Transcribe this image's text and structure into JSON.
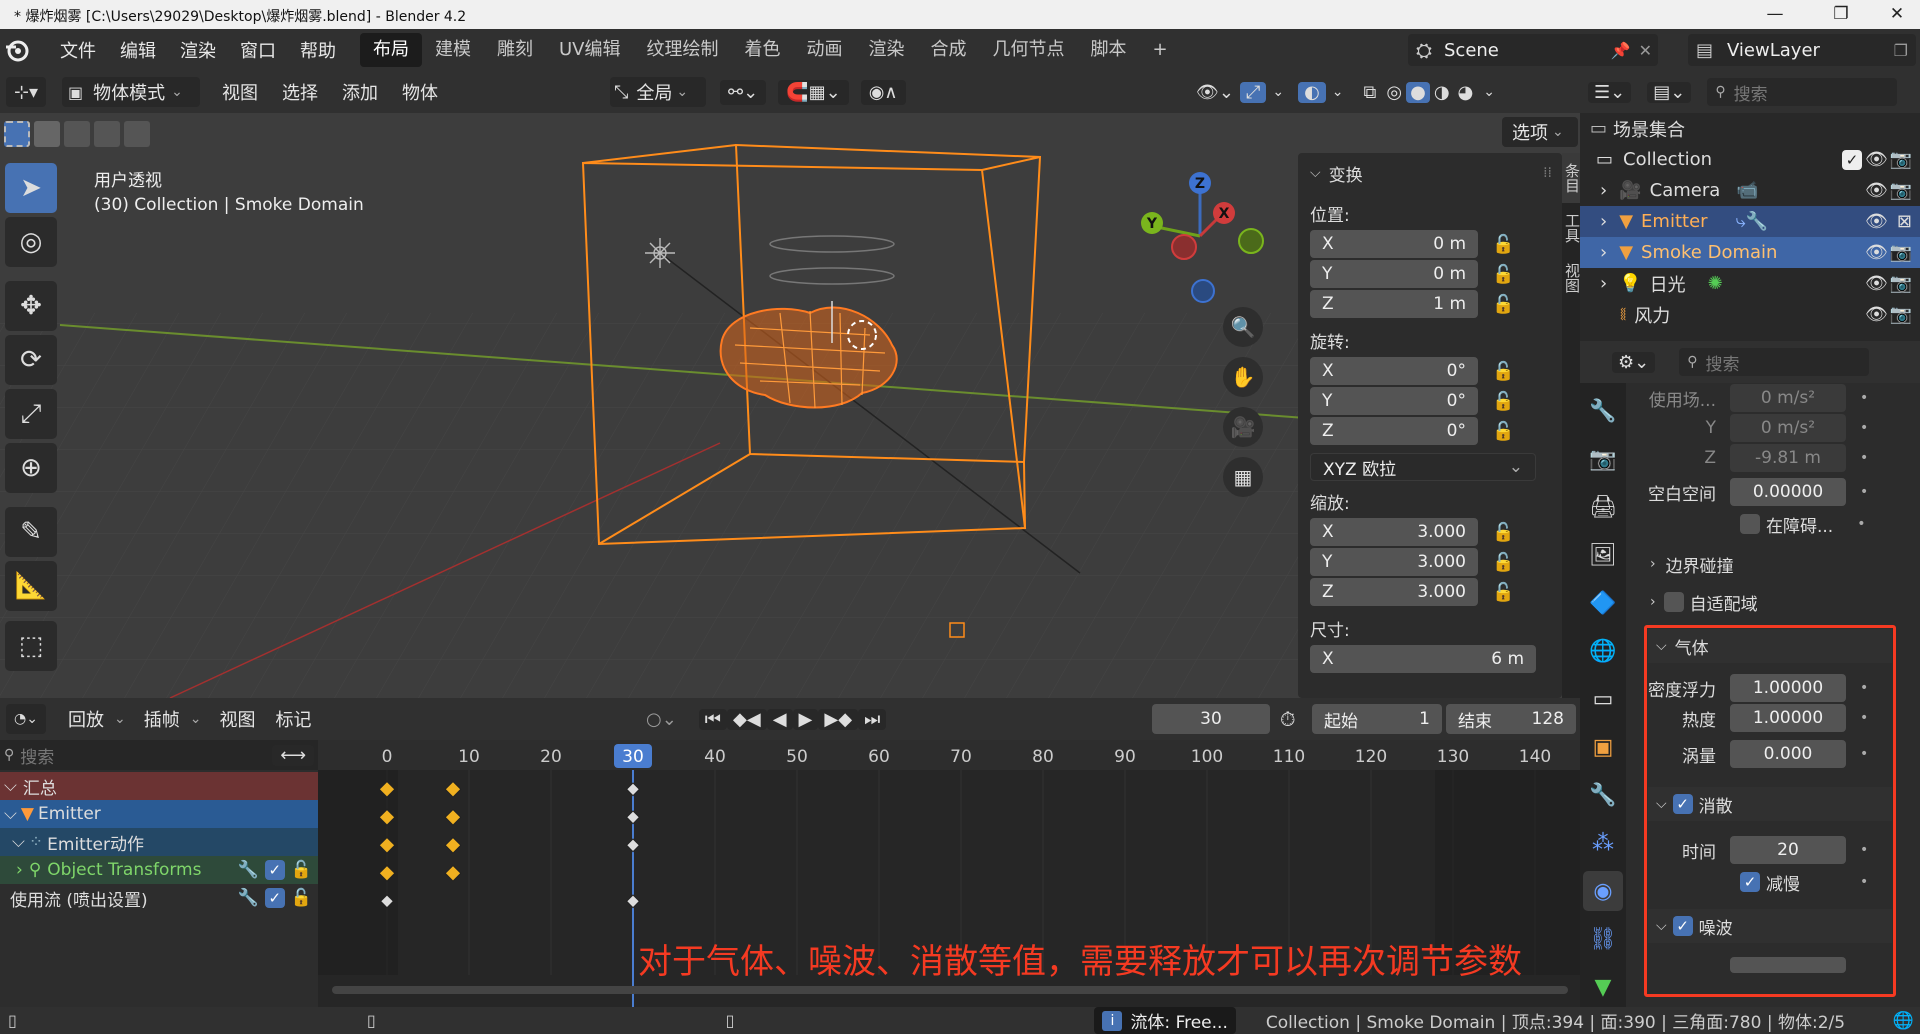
{
  "window": {
    "title": "* 爆炸烟雾 [C:\\Users\\29029\\Desktop\\爆炸烟雾.blend] - Blender 4.2",
    "minimize": "—",
    "maximize": "❐",
    "close": "✕"
  },
  "menu": [
    "文件",
    "编辑",
    "渲染",
    "窗口",
    "帮助"
  ],
  "workspaces": [
    "布局",
    "建模",
    "雕刻",
    "UV编辑",
    "纹理绘制",
    "着色",
    "动画",
    "渲染",
    "合成",
    "几何节点",
    "脚本"
  ],
  "workspace_add": "+",
  "scene": {
    "name": "Scene",
    "view_layer": "ViewLayer"
  },
  "viewport": {
    "mode": "物体模式",
    "menus": [
      "视图",
      "选择",
      "添加",
      "物体"
    ],
    "transform_orientation": "全局",
    "options_label": "选项",
    "overlay_title": "用户透视",
    "overlay_info": "(30) Collection | Smoke Domain",
    "gizmo_axes": [
      "Z",
      "Y",
      "X"
    ]
  },
  "n_panel": {
    "section": "变换",
    "location_label": "位置:",
    "location": [
      {
        "axis": "X",
        "value": "0 m"
      },
      {
        "axis": "Y",
        "value": "0 m"
      },
      {
        "axis": "Z",
        "value": "1 m"
      }
    ],
    "rotation_label": "旋转:",
    "rotation": [
      {
        "axis": "X",
        "value": "0°"
      },
      {
        "axis": "Y",
        "value": "0°"
      },
      {
        "axis": "Z",
        "value": "0°"
      }
    ],
    "rotation_mode": "XYZ 欧拉",
    "scale_label": "缩放:",
    "scale": [
      {
        "axis": "X",
        "value": "3.000"
      },
      {
        "axis": "Y",
        "value": "3.000"
      },
      {
        "axis": "Z",
        "value": "3.000"
      }
    ],
    "dimensions_label": "尺寸:",
    "dimensions": [
      {
        "axis": "X",
        "value": "6 m"
      }
    ],
    "tabs": [
      "条目",
      "工具",
      "视图"
    ]
  },
  "timeline": {
    "menus": [
      "回放",
      "插帧",
      "视图",
      "标记"
    ],
    "current_frame": "30",
    "start_label": "起始",
    "start": "1",
    "end_label": "结束",
    "end": "128",
    "search_placeholder": "搜索",
    "ruler": [
      "0",
      "10",
      "20",
      "30",
      "40",
      "50",
      "60",
      "70",
      "80",
      "90",
      "100",
      "110",
      "120",
      "130",
      "140"
    ],
    "channels": [
      "汇总",
      "Emitter",
      "Emitter动作",
      "Object Transforms",
      "使用流 (喷出设置)"
    ],
    "caption": "对于气体、噪波、消散等值，需要释放才可以再次调节参数"
  },
  "outliner": {
    "search_placeholder": "搜索",
    "root": "场景集合",
    "items": [
      "Collection",
      "Camera",
      "Emitter",
      "Smoke Domain",
      "日光",
      "风力"
    ]
  },
  "properties": {
    "search_placeholder": "搜索",
    "gravity_label": "使用场...",
    "gravity": [
      {
        "axis": "",
        "value": "0 m/s²"
      },
      {
        "axis": "Y",
        "value": "0 m/s²"
      },
      {
        "axis": "Z",
        "value": "-9.81 m"
      }
    ],
    "empty_space_label": "空白空间",
    "empty_space": "0.00000",
    "obstacle_label": "在障碍...",
    "border_collisions": "边界碰撞",
    "adaptive_domain": "自适配域",
    "gas_section": "气体",
    "buoyancy_density_label": "密度浮力",
    "buoyancy_density": "1.00000",
    "heat_label": "热度",
    "heat": "1.00000",
    "vorticity_label": "涡量",
    "vorticity": "0.000",
    "dissolve_label": "消散",
    "time_label": "时间",
    "time": "20",
    "slow_label": "减慢",
    "noise_label": "噪波"
  },
  "statusbar": {
    "info": "流体: Free...",
    "stats": "Collection | Smoke Domain | 顶点:394 | 面:390 | 三角面:780 | 物体:2/5"
  },
  "colors": {
    "accent": "#4772b3",
    "caption": "#f53a22",
    "orange": "#ff8c1a",
    "selected_row": "#334d80"
  }
}
